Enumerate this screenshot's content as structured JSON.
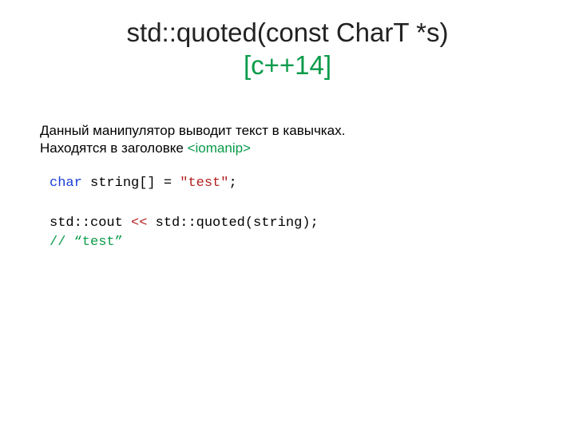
{
  "title": {
    "main": "std::quoted(const CharT *s)",
    "standard": "[c++14]"
  },
  "desc": {
    "line1": "Данный манипулятор выводит текст в кавычках.",
    "line2_prefix": "Находятся в заголовке ",
    "header": "<iomanip>"
  },
  "code": {
    "kw_char": "char",
    "decl_rest": " string[] = ",
    "str_literal": "\"test\"",
    "semicolon": ";",
    "cout": "std::cout ",
    "op": "<<",
    "call": " std::quoted(string);",
    "comment": "// “test”"
  }
}
